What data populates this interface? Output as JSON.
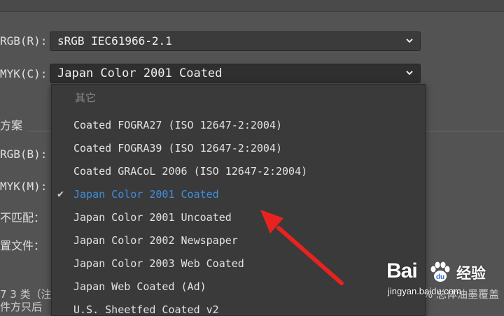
{
  "settings": {
    "rgb_label": "RGB(R):",
    "rgb_value": "sRGB IEC61966-2.1",
    "cmyk_label": "MYK(C):",
    "cmyk_value": "Japan Color 2001 Coated",
    "section_title": "方案",
    "rgb_b_label": "RGB(B):",
    "cmyk_m_label": "MYK(M):",
    "mismatch_label": "不匹配：",
    "profile_label": "置文件："
  },
  "dropdown": {
    "group_label": "其它",
    "items": [
      {
        "label": "Coated FOGRA27 (ISO 12647-2:2004)",
        "selected": false
      },
      {
        "label": "Coated FOGRA39 (ISO 12647-2:2004)",
        "selected": false
      },
      {
        "label": "Coated GRACoL 2006 (ISO 12647-2:2004)",
        "selected": false
      },
      {
        "label": "Japan Color 2001 Coated",
        "selected": true
      },
      {
        "label": "Japan Color 2001 Uncoated",
        "selected": false
      },
      {
        "label": "Japan Color 2002 Newspaper",
        "selected": false
      },
      {
        "label": "Japan Color 2003 Web Coated",
        "selected": false
      },
      {
        "label": "Japan Web Coated (Ad)",
        "selected": false
      },
      {
        "label": "U.S. Sheetfed Coated v2",
        "selected": false
      }
    ],
    "check_glyph": "✔"
  },
  "bottom": {
    "line1": "7 3 类（注",
    "line2": "件方只后",
    "right_line": "% 总体油墨覆盖"
  },
  "watermark": {
    "brand": "Bai",
    "brand_suffix": "du",
    "cn": "经验",
    "url": "jingyan.baidu.com"
  },
  "icons": {
    "dropdown_chevron": "chevron-down-icon",
    "annotation": "red-arrow-icon",
    "paw": "baidu-paw-icon"
  },
  "colors": {
    "panel": "#535353",
    "selected_item": "#3f8fdd",
    "arrow": "#e8231f"
  }
}
